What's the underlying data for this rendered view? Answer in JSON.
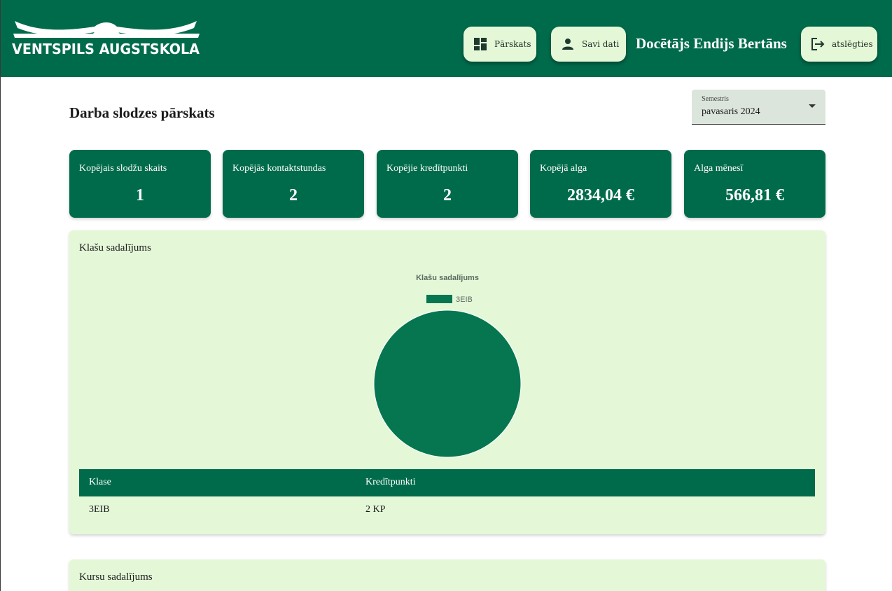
{
  "header": {
    "logo_text": "VENTSPILS AUGSTSKOLA",
    "nav": {
      "overview_label": "Pārskats",
      "profile_label": "Savi dati",
      "logout_label": "atslēgties"
    },
    "user_name": "Docētājs Endijs Bertāns"
  },
  "page": {
    "title": "Darba slodzes pārskats"
  },
  "semester_select": {
    "label": "Semestris",
    "value": "pavasaris 2024"
  },
  "stats": [
    {
      "title": "Kopējais slodžu skaits",
      "value": "1"
    },
    {
      "title": "Kopējās kontaktstundas",
      "value": "2"
    },
    {
      "title": "Kopējie kredītpunkti",
      "value": "2"
    },
    {
      "title": "Kopējā alga",
      "value": "2834,04 €"
    },
    {
      "title": "Alga mēnesī",
      "value": "566,81 €"
    }
  ],
  "class_panel": {
    "title": "Klašu sadalījums",
    "table": {
      "headers": [
        "Klase",
        "Kredītpunkti"
      ],
      "rows": [
        [
          "3EIB",
          "2 KP"
        ]
      ]
    }
  },
  "course_panel": {
    "title": "Kursu sadalījums"
  },
  "chart_data": {
    "type": "pie",
    "title": "Klašu sadalījums",
    "categories": [
      "3EIB"
    ],
    "values": [
      2
    ],
    "colors": [
      "#067651"
    ],
    "legend": "top"
  },
  "colors": {
    "primary": "#006b4b",
    "panel_bg": "#e4f8d8",
    "pie_slice": "#067651"
  }
}
